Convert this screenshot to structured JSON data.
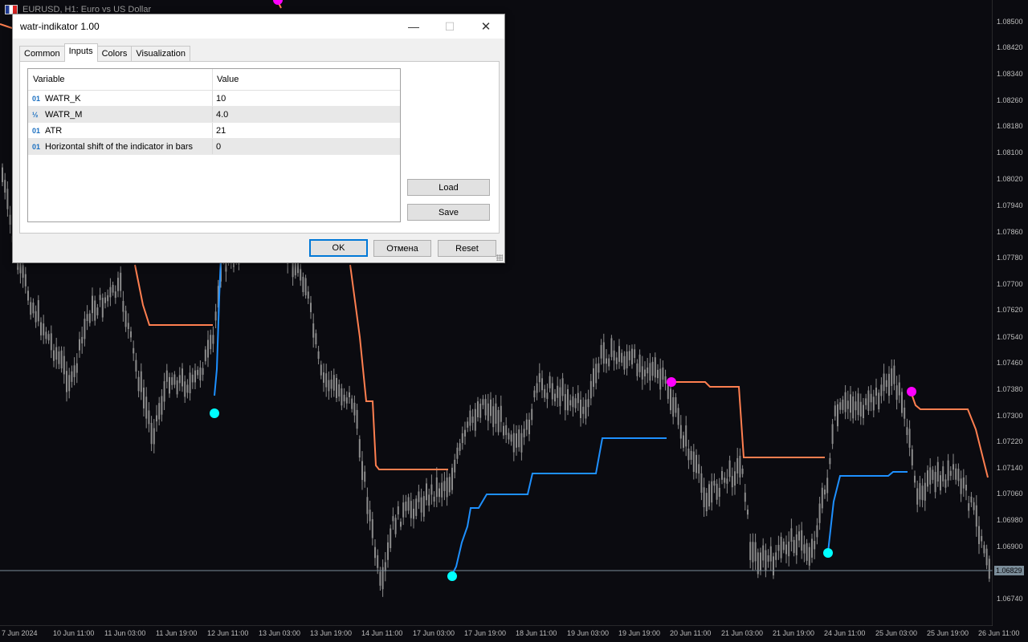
{
  "chart": {
    "title": "EURUSD, H1:  Euro vs US Dollar",
    "price_labels": [
      "1.08500",
      "1.08420",
      "1.08340",
      "1.08260",
      "1.08180",
      "1.08100",
      "1.08020",
      "1.07940",
      "1.07860",
      "1.07780",
      "1.07700",
      "1.07620",
      "1.07540",
      "1.07460",
      "1.07380",
      "1.07300",
      "1.07220",
      "1.07140",
      "1.07060",
      "1.06980",
      "1.06900",
      "1.06740"
    ],
    "current_price": "1.06829",
    "time_labels": [
      "7 Jun 2024",
      "10 Jun 11:00",
      "11 Jun 03:00",
      "11 Jun 19:00",
      "12 Jun 11:00",
      "13 Jun 03:00",
      "13 Jun 19:00",
      "14 Jun 11:00",
      "17 Jun 03:00",
      "17 Jun 19:00",
      "18 Jun 11:00",
      "19 Jun 03:00",
      "19 Jun 19:00",
      "20 Jun 11:00",
      "21 Jun 03:00",
      "21 Jun 19:00",
      "24 Jun 11:00",
      "25 Jun 03:00",
      "25 Jun 19:00",
      "26 Jun 11:00"
    ],
    "colors": {
      "background": "#0b0b10",
      "candles": "#8c8c8c",
      "upper_line": "#ff7f50",
      "lower_line": "#1e90ff",
      "sell_marker": "#ff00ff",
      "buy_marker": "#00ffff",
      "price_line": "#7b8d99"
    }
  },
  "dialog": {
    "title": "watr-indikator 1.00",
    "tabs": [
      "Common",
      "Inputs",
      "Colors",
      "Visualization"
    ],
    "active_tab": "Inputs",
    "table": {
      "headers": [
        "Variable",
        "Value"
      ],
      "rows": [
        {
          "icon": "01",
          "variable": "WATR_K",
          "value": "10"
        },
        {
          "icon": "½",
          "variable": "WATR_M",
          "value": "4.0"
        },
        {
          "icon": "01",
          "variable": "ATR",
          "value": "21"
        },
        {
          "icon": "01",
          "variable": "Horizontal shift of the indicator in bars",
          "value": "0"
        }
      ]
    },
    "buttons": {
      "load": "Load",
      "save": "Save",
      "ok": "OK",
      "cancel": "Отмена",
      "reset": "Reset"
    },
    "window_controls": {
      "minimize": "—",
      "maximize": "☐",
      "close": "✕"
    }
  }
}
